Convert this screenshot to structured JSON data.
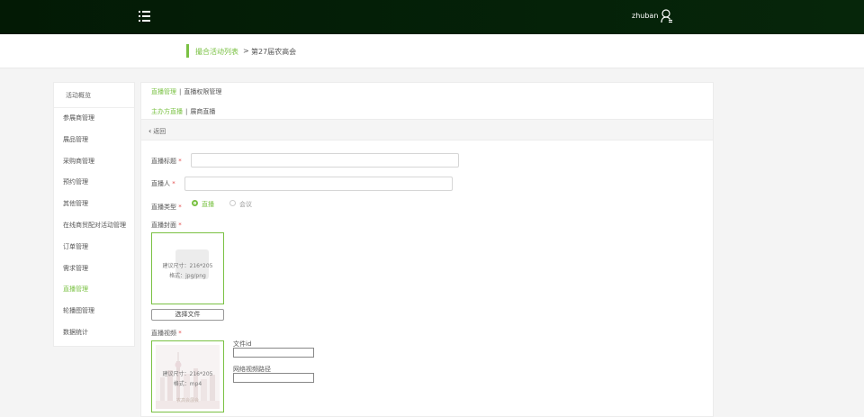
{
  "header": {
    "username": "zhuban"
  },
  "breadcrumb": {
    "link": "撮合活动列表",
    "separator": ">",
    "current": "第27届农高会"
  },
  "sidebar": {
    "title": "活动概览",
    "items": [
      {
        "label": "参展商管理"
      },
      {
        "label": "展品管理"
      },
      {
        "label": "采购商管理"
      },
      {
        "label": "预约管理"
      },
      {
        "label": "其他管理"
      },
      {
        "label": "在线商贸配对活动管理"
      },
      {
        "label": "订单管理"
      },
      {
        "label": "需求管理"
      },
      {
        "label": "直播管理",
        "active": true
      },
      {
        "label": "轮播图管理"
      },
      {
        "label": "数据统计"
      }
    ]
  },
  "tabs": {
    "primary": [
      "直播管理",
      "直播权限管理"
    ],
    "secondary": [
      "主办方直播",
      "展商直播"
    ],
    "separator": "|"
  },
  "back": {
    "label": "返回"
  },
  "form": {
    "title_label": "直播标题",
    "host_label": "直播人",
    "type_label": "直播类型",
    "type_options": [
      "直播",
      "会议"
    ],
    "cover_label": "直播封面",
    "cover_hint_size": "建议尺寸：216*205",
    "cover_hint_format": "格式：jpg/png",
    "choose_file": "选择文件",
    "video_label": "直播视频",
    "video_hint_size": "建议尺寸：216*205",
    "video_hint_format": "格式：mp4",
    "video_watermark": "农高会展会",
    "file_id_label": "文件id",
    "network_path_label": "网络视频路径",
    "required_mark": "*"
  },
  "colors": {
    "accent": "#7ac143",
    "topbar": "#031a05",
    "required": "#e34b4b"
  }
}
